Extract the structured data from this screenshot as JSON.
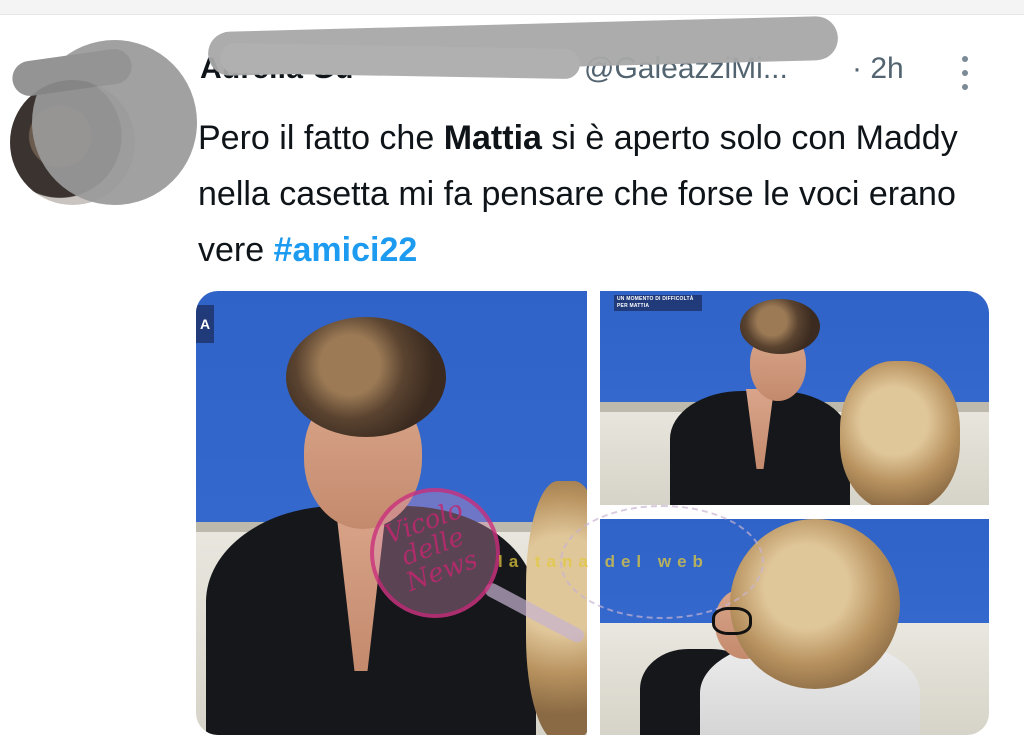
{
  "tweet": {
    "author_name": "Aurelia Gu",
    "author_handle": "@GaleazziMi...",
    "time": "· 2h",
    "more_icon": "vertical-dots-icon",
    "text_before": "Pero il fatto che ",
    "text_bold": "Mattia",
    "text_after": " si è aperto solo con Maddy nella casetta mi fa pensare che forse le voci erano vere ",
    "hashtag": "#amici22"
  },
  "media": {
    "left_badge": "A",
    "overlay_caption": "UN MOMENTO DI DIFFICOLTÀ PER MATTIA"
  },
  "watermarks": {
    "vicolo": "Vicolo delle News",
    "tana": "la tana del web"
  },
  "colors": {
    "hashtag": "#1d9bf0",
    "meta": "#536471",
    "text": "#0f1419",
    "wall_blue": "#3468cc"
  }
}
